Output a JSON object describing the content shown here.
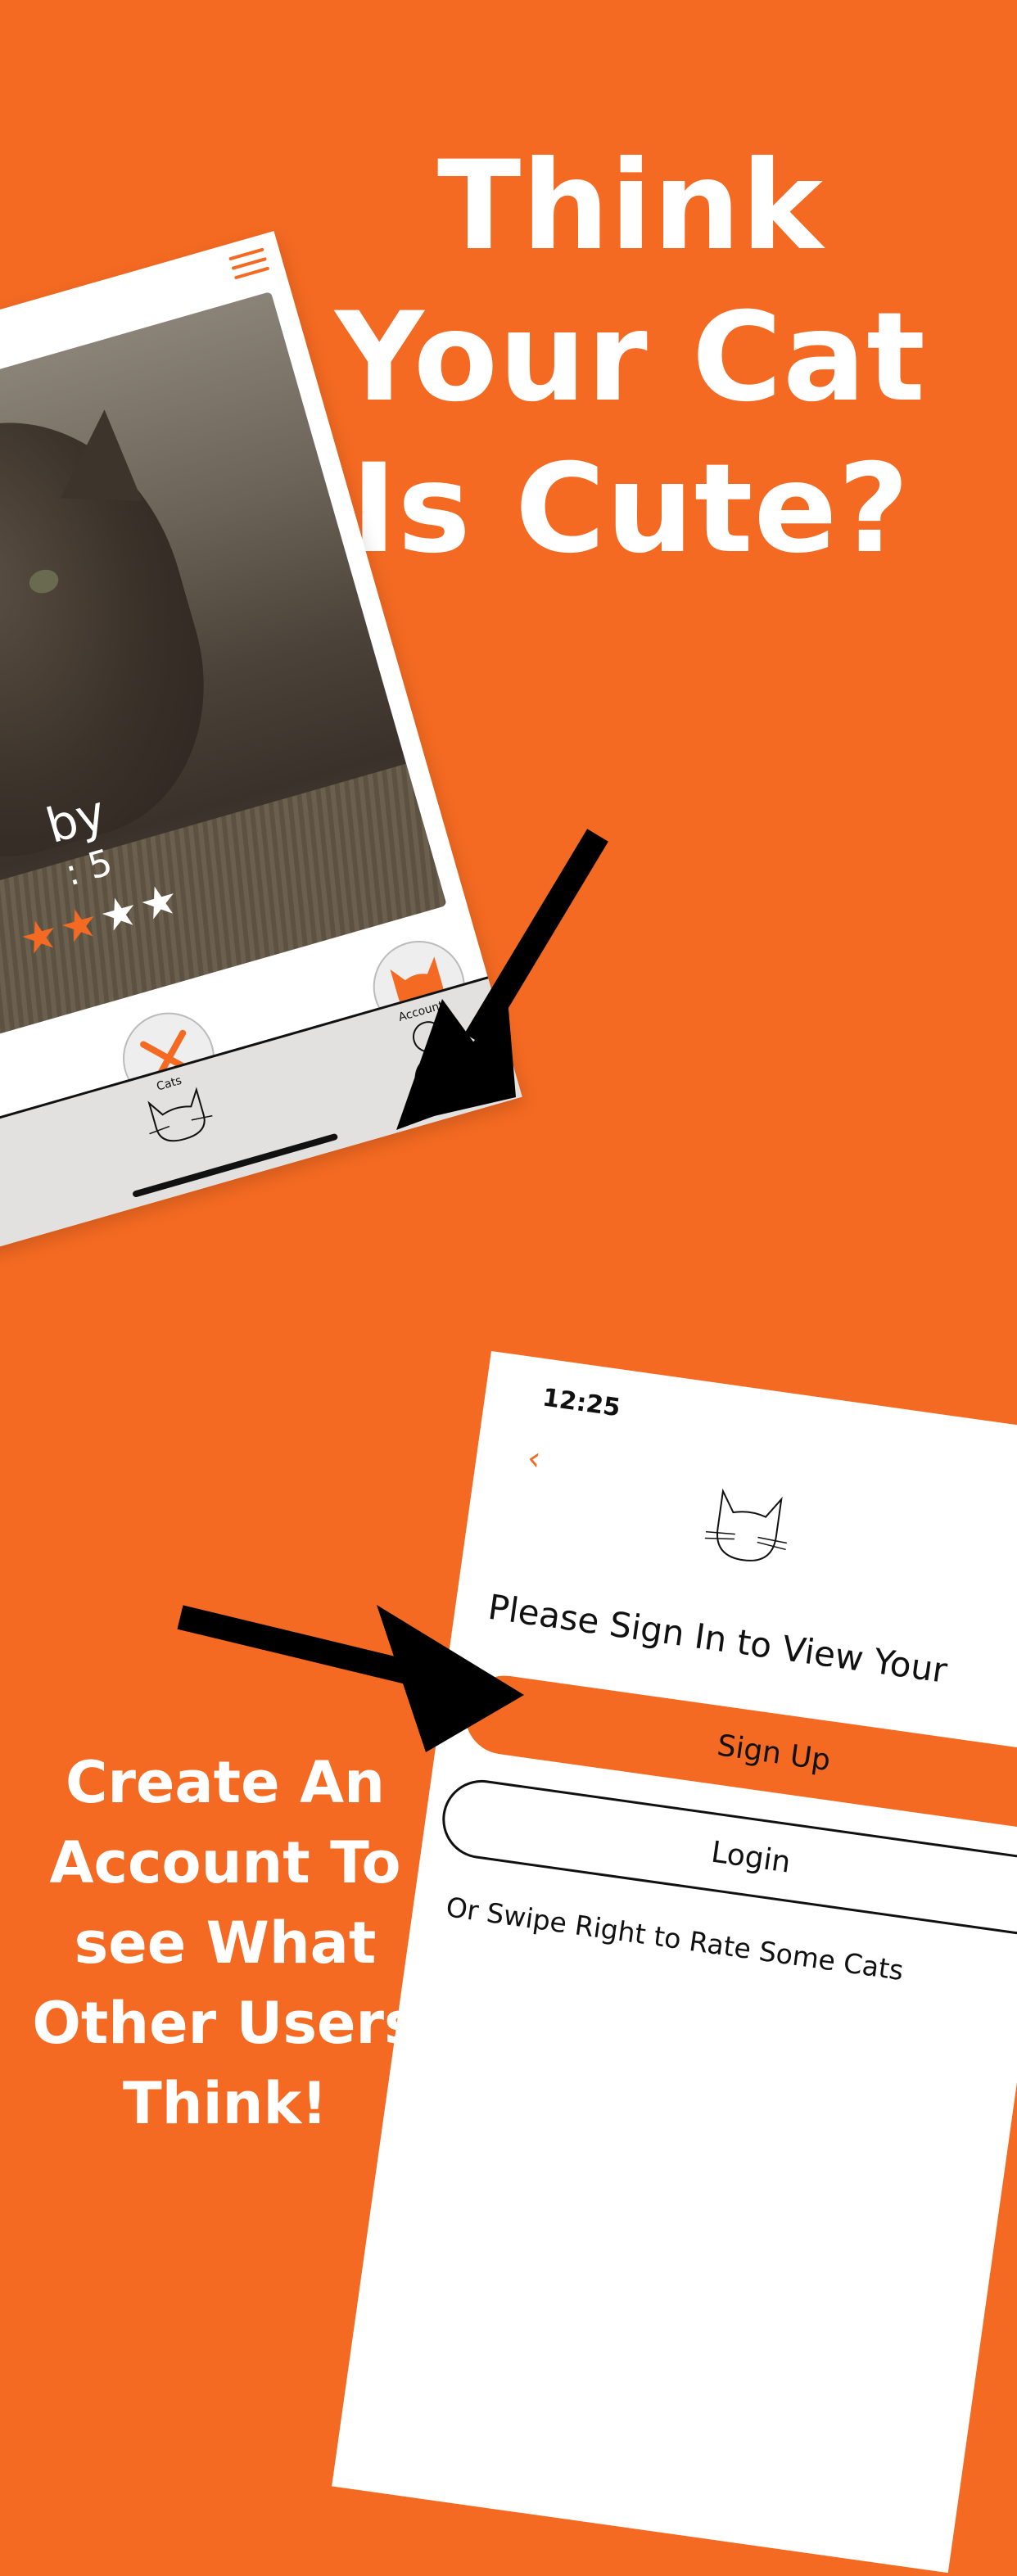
{
  "headline": "Think Your Cat Is Cute?",
  "subline": "Create An Account To see What Other Users Think!",
  "colors": {
    "accent": "#f46a22",
    "background": "#f46a22",
    "text_light": "#ffffff"
  },
  "phone1": {
    "cat_name_partial": "by",
    "cat_age_partial": ": 5",
    "rating": {
      "filled": 2,
      "total": 5
    },
    "tabs": {
      "cats_label": "Cats",
      "account_label": "Account"
    },
    "icons": [
      "menu-icon",
      "close-x-icon",
      "cat-face-icon",
      "account-icon"
    ]
  },
  "phone2": {
    "time": "12:25",
    "back_icon": "‹",
    "title": "Please Sign In to View Your",
    "signup_label": "Sign Up",
    "login_label": "Login",
    "swipe_text": "Or Swipe Right to Rate Some Cats"
  }
}
